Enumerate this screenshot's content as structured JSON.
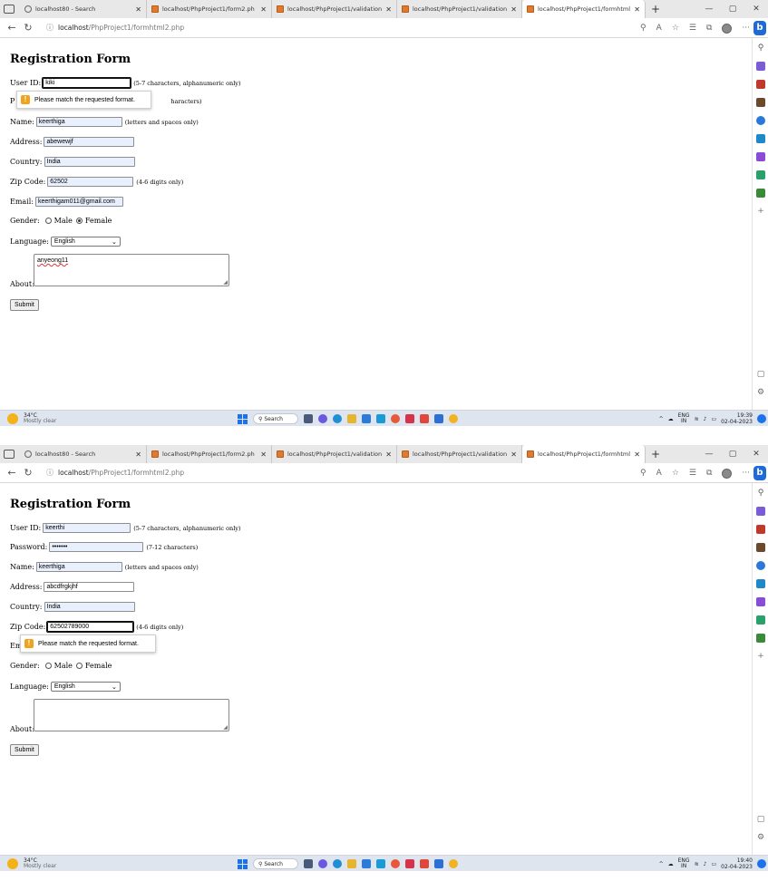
{
  "browser": {
    "tabs": [
      {
        "title": "localhost80 - Search",
        "fav": "search"
      },
      {
        "title": "localhost/PhpProject1/form2.ph",
        "fav": "site"
      },
      {
        "title": "localhost/PhpProject1/validation",
        "fav": "site"
      },
      {
        "title": "localhost/PhpProject1/validation",
        "fav": "site"
      },
      {
        "title": "localhost/PhpProject1/formhtml",
        "fav": "site"
      }
    ],
    "url_host": "localhost",
    "url_path": "/PhpProject1/formhtml2.php"
  },
  "form": {
    "title": "Registration Form",
    "labels": {
      "userid": "User ID:",
      "password": "Password:",
      "name": "Name:",
      "address": "Address:",
      "country": "Country:",
      "zip": "Zip Code:",
      "email": "Email:",
      "gender": "Gender:",
      "male": "Male",
      "female": "Female",
      "language": "Language:",
      "about": "About:",
      "submit": "Submit"
    },
    "hints": {
      "userid": "(5-7 characters, alphanumeric only)",
      "password": "(7-12 characters)",
      "name": "(letters and spaces only)",
      "zip": "(4-6 digits only)"
    },
    "validation_message": "Please match the requested format."
  },
  "screenshot1": {
    "userid": "kiki",
    "password_hint_visible": "haracters)",
    "password_label_visible": "P",
    "name": "keerthiga",
    "address": "abewewjf",
    "country": "India",
    "zip": "62502",
    "email": "keerthigam011@gmail.com",
    "gender": "female",
    "language": "English",
    "about": "anyeong11"
  },
  "screenshot2": {
    "userid": "keerthi",
    "password": "•••••••",
    "name": "keerthiga",
    "address": "abcdfrgkjhf",
    "country": "India",
    "zip": "62502789000",
    "email_label_visible": "Em",
    "gender": "none",
    "language": "English",
    "about": ""
  },
  "taskbar": {
    "temp": "34°C",
    "weather": "Mostly clear",
    "search": "Search",
    "lang1": "ENG",
    "lang2": "IN",
    "time1": "19:39",
    "time2": "19:40",
    "date": "02-04-2023"
  },
  "colors": {
    "autofill": "#e8f0fe",
    "warning": "#f1a31c",
    "accent": "#1a73e8"
  }
}
